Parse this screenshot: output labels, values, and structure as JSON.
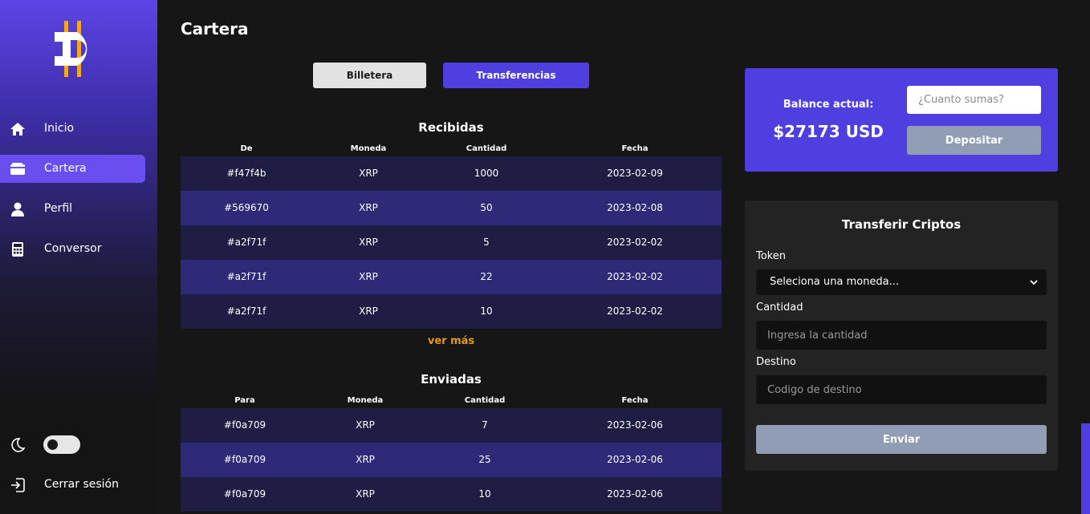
{
  "sidebar": {
    "logo_icon": "app-logo",
    "items": [
      {
        "label": "Inicio",
        "icon": "home-icon",
        "active": false
      },
      {
        "label": "Cartera",
        "icon": "wallet-icon",
        "active": true
      },
      {
        "label": "Perfil",
        "icon": "user-icon",
        "active": false
      },
      {
        "label": "Conversor",
        "icon": "calculator-icon",
        "active": false
      }
    ],
    "theme_toggle": {
      "icon": "moon-icon",
      "on": false
    },
    "logout": {
      "label": "Cerrar sesión",
      "icon": "logout-icon"
    }
  },
  "page": {
    "title": "Cartera"
  },
  "tabs": {
    "wallet": "Billetera",
    "transfers": "Transferencias",
    "active": "transfers"
  },
  "received": {
    "title": "Recibidas",
    "headers": [
      "De",
      "Moneda",
      "Cantidad",
      "Fecha"
    ],
    "rows": [
      [
        "#f47f4b",
        "XRP",
        "1000",
        "2023-02-09"
      ],
      [
        "#569670",
        "XRP",
        "50",
        "2023-02-08"
      ],
      [
        "#a2f71f",
        "XRP",
        "5",
        "2023-02-02"
      ],
      [
        "#a2f71f",
        "XRP",
        "22",
        "2023-02-02"
      ],
      [
        "#a2f71f",
        "XRP",
        "10",
        "2023-02-02"
      ]
    ],
    "more_label": "ver más"
  },
  "sent": {
    "title": "Enviadas",
    "headers": [
      "Para",
      "Moneda",
      "Cantidad",
      "Fecha"
    ],
    "rows": [
      [
        "#f0a709",
        "XRP",
        "7",
        "2023-02-06"
      ],
      [
        "#f0a709",
        "XRP",
        "25",
        "2023-02-06"
      ],
      [
        "#f0a709",
        "XRP",
        "10",
        "2023-02-06"
      ]
    ]
  },
  "balance": {
    "label": "Balance actual:",
    "value": "$27173 USD",
    "input_placeholder": "¿Cuanto sumas?",
    "deposit_label": "Depositar"
  },
  "transfer": {
    "title": "Transferir Criptos",
    "token_label": "Token",
    "token_selected": "Seleciona una moneda...",
    "amount_label": "Cantidad",
    "amount_placeholder": "Ingresa la cantidad",
    "dest_label": "Destino",
    "dest_placeholder": "Codigo de destino",
    "send_label": "Enviar"
  },
  "colors": {
    "accent": "#4f3fe0",
    "sidebar_active": "#6a4ef0",
    "row_odd": "#201d45",
    "row_even": "#2e2a78",
    "link": "#e49a1c",
    "disabled_button": "#919db5",
    "logo_gold": "#f5a623"
  }
}
